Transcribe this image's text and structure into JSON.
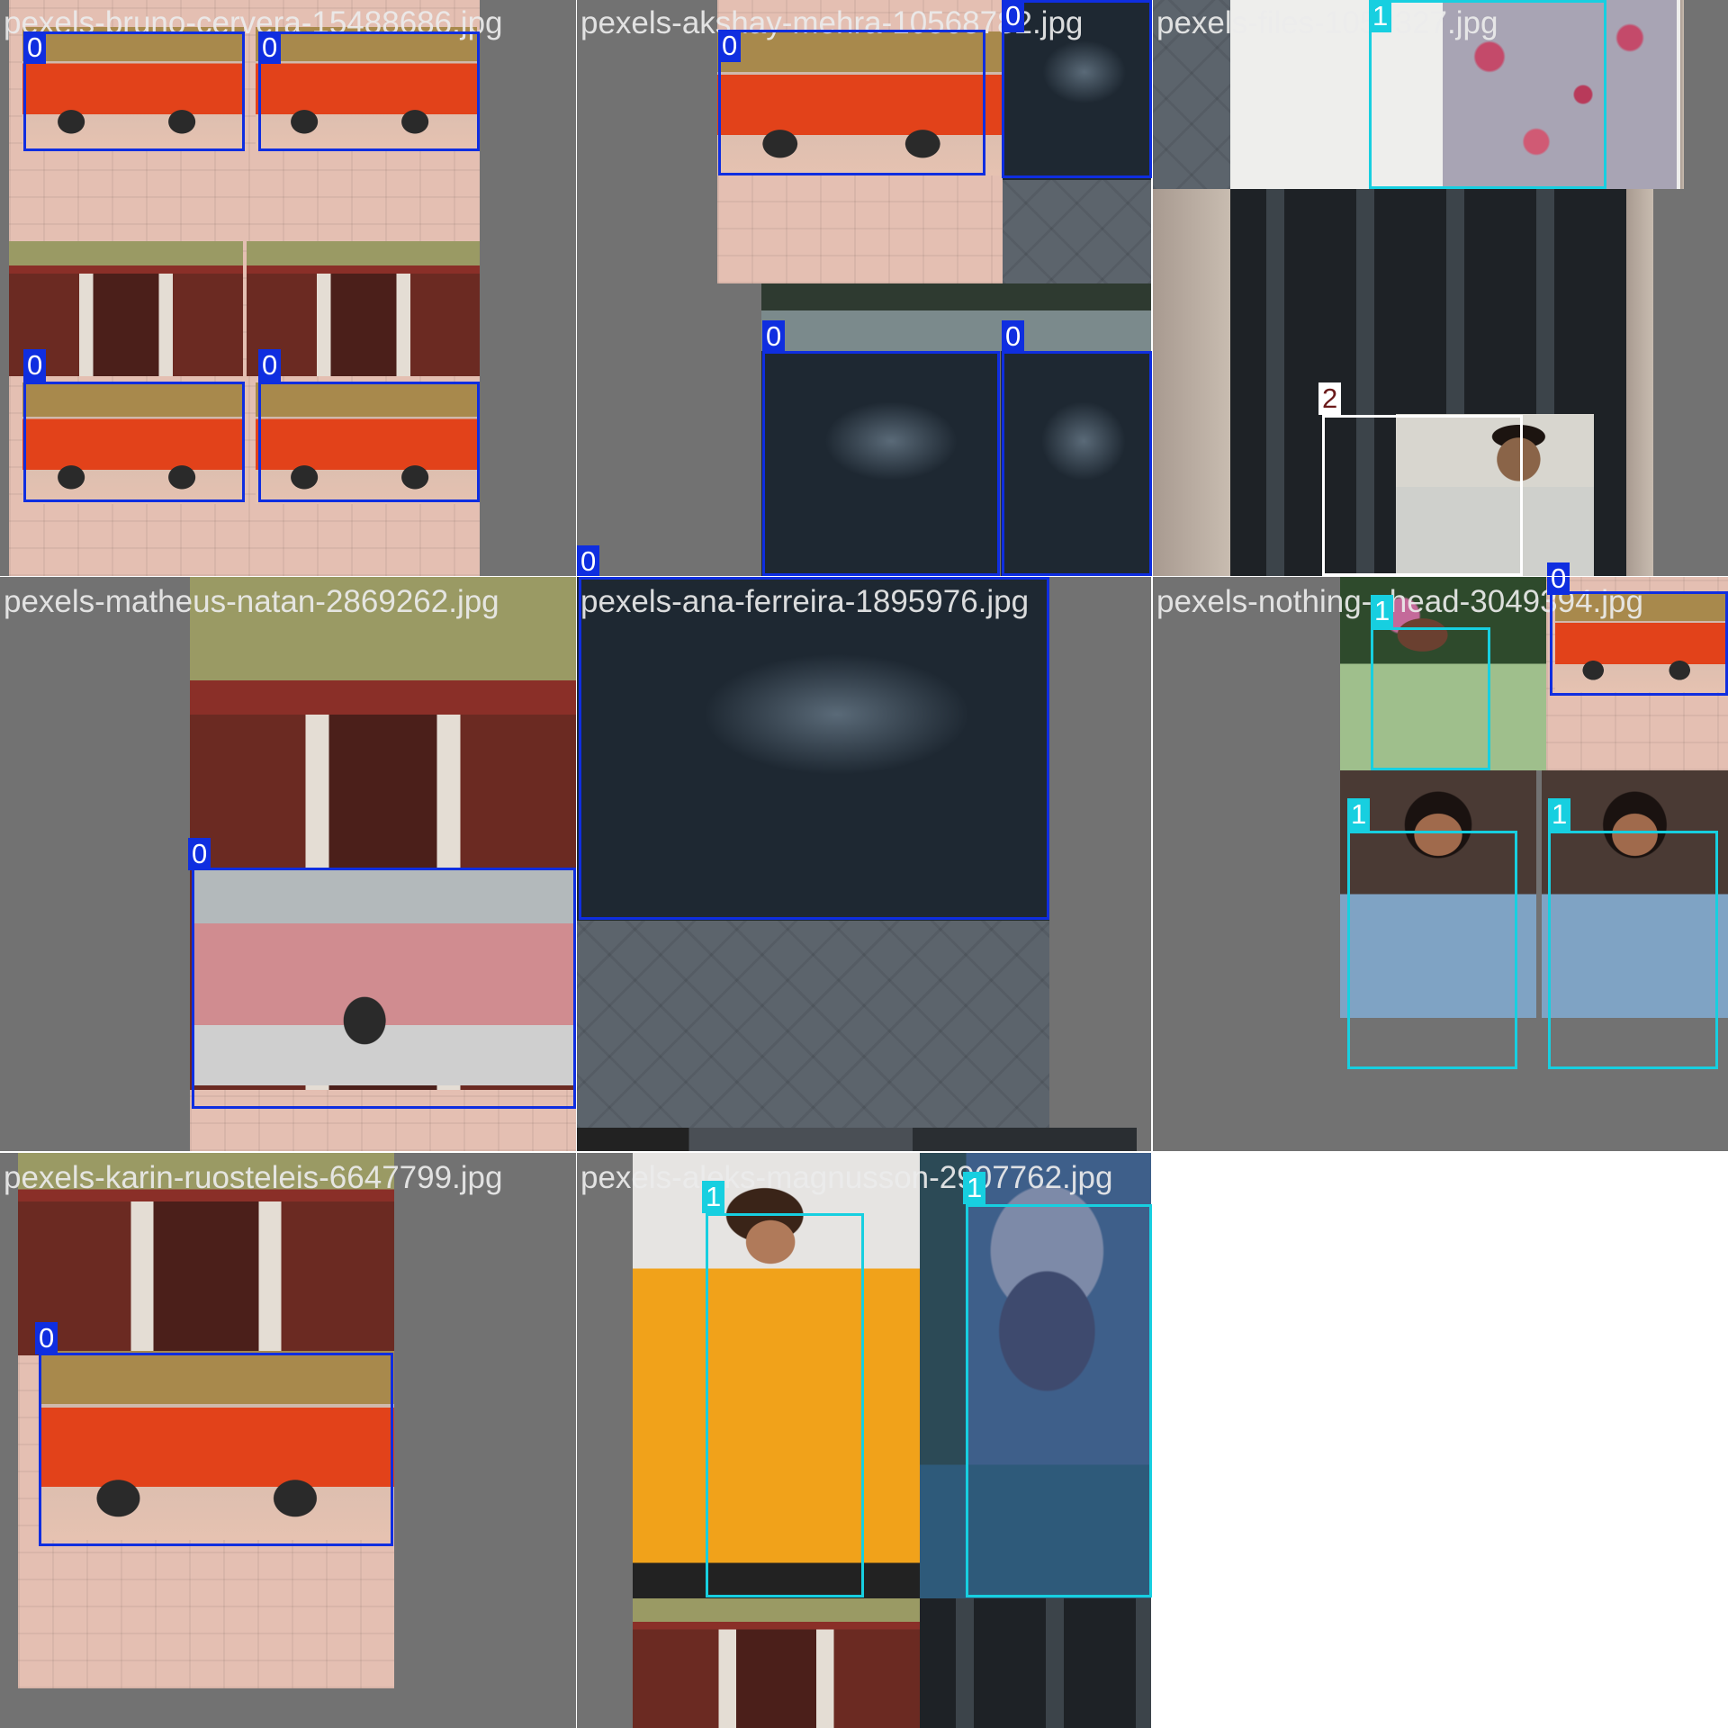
{
  "colors": {
    "class_0": "#0f2ee0",
    "class_1": "#17cfe0",
    "class_2": "#ffffff",
    "class_2_text": "#6b1a1a",
    "padding": "#727272"
  },
  "tiles": [
    {
      "filename": "pexels-bruno-cervera-15488686.jpg"
    },
    {
      "filename": "pexels-akshay-mehra-10568782.jpg"
    },
    {
      "filename": "pexels-files-1050327.jpg"
    },
    {
      "filename": "pexels-matheus-natan-2869262.jpg"
    },
    {
      "filename": "pexels-ana-ferreira-1895976.jpg"
    },
    {
      "filename": "pexels-nothing-ahead-3049394.jpg"
    },
    {
      "filename": "pexels-karin-ruosteleis-6647799.jpg"
    },
    {
      "filename": "pexels-aleks-magnusson-2907762.jpg"
    }
  ],
  "labels": {
    "car": "0",
    "person": "1",
    "other": "2"
  }
}
